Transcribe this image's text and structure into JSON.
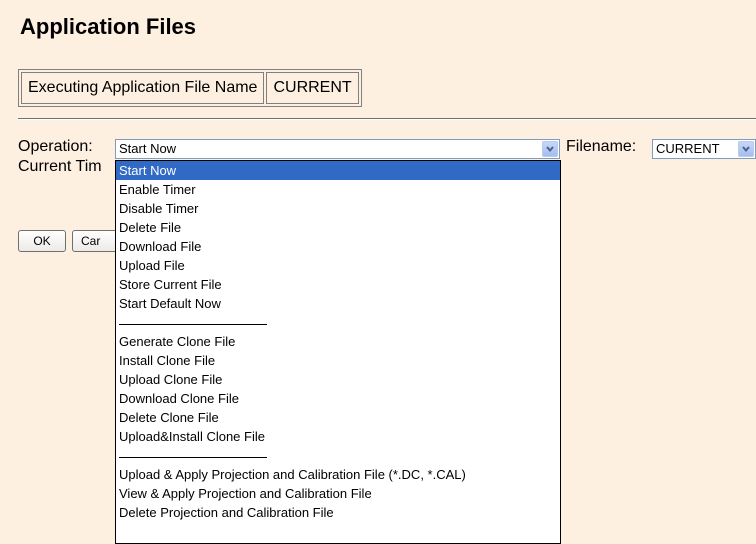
{
  "page": {
    "title": "Application Files"
  },
  "info": {
    "label": "Executing Application File Name",
    "value": "CURRENT"
  },
  "form": {
    "operation_label": "Operation:",
    "operation_value": "Start Now",
    "filename_label": "Filename:",
    "filename_value": "CURRENT",
    "current_time_label": "Current Tim",
    "ok_label": "OK",
    "cancel_label": "Car"
  },
  "dropdown": {
    "options": [
      "Start Now",
      "Enable Timer",
      "Disable Timer",
      "Delete File",
      "Download File",
      "Upload File",
      "Store Current File",
      "Start Default Now",
      "",
      "Generate Clone File",
      "Install Clone File",
      "Upload Clone File",
      "Download Clone File",
      "Delete Clone File",
      "Upload&Install Clone File",
      "",
      "Upload & Apply Projection and Calibration File (*.DC, *.CAL)",
      "View & Apply Projection and Calibration File",
      "Delete Projection and Calibration File"
    ]
  },
  "colors": {
    "background": "#fdf0e1",
    "selection": "#316ac5"
  },
  "icons": {
    "dropdown_arrow": "chevron-down-icon"
  }
}
